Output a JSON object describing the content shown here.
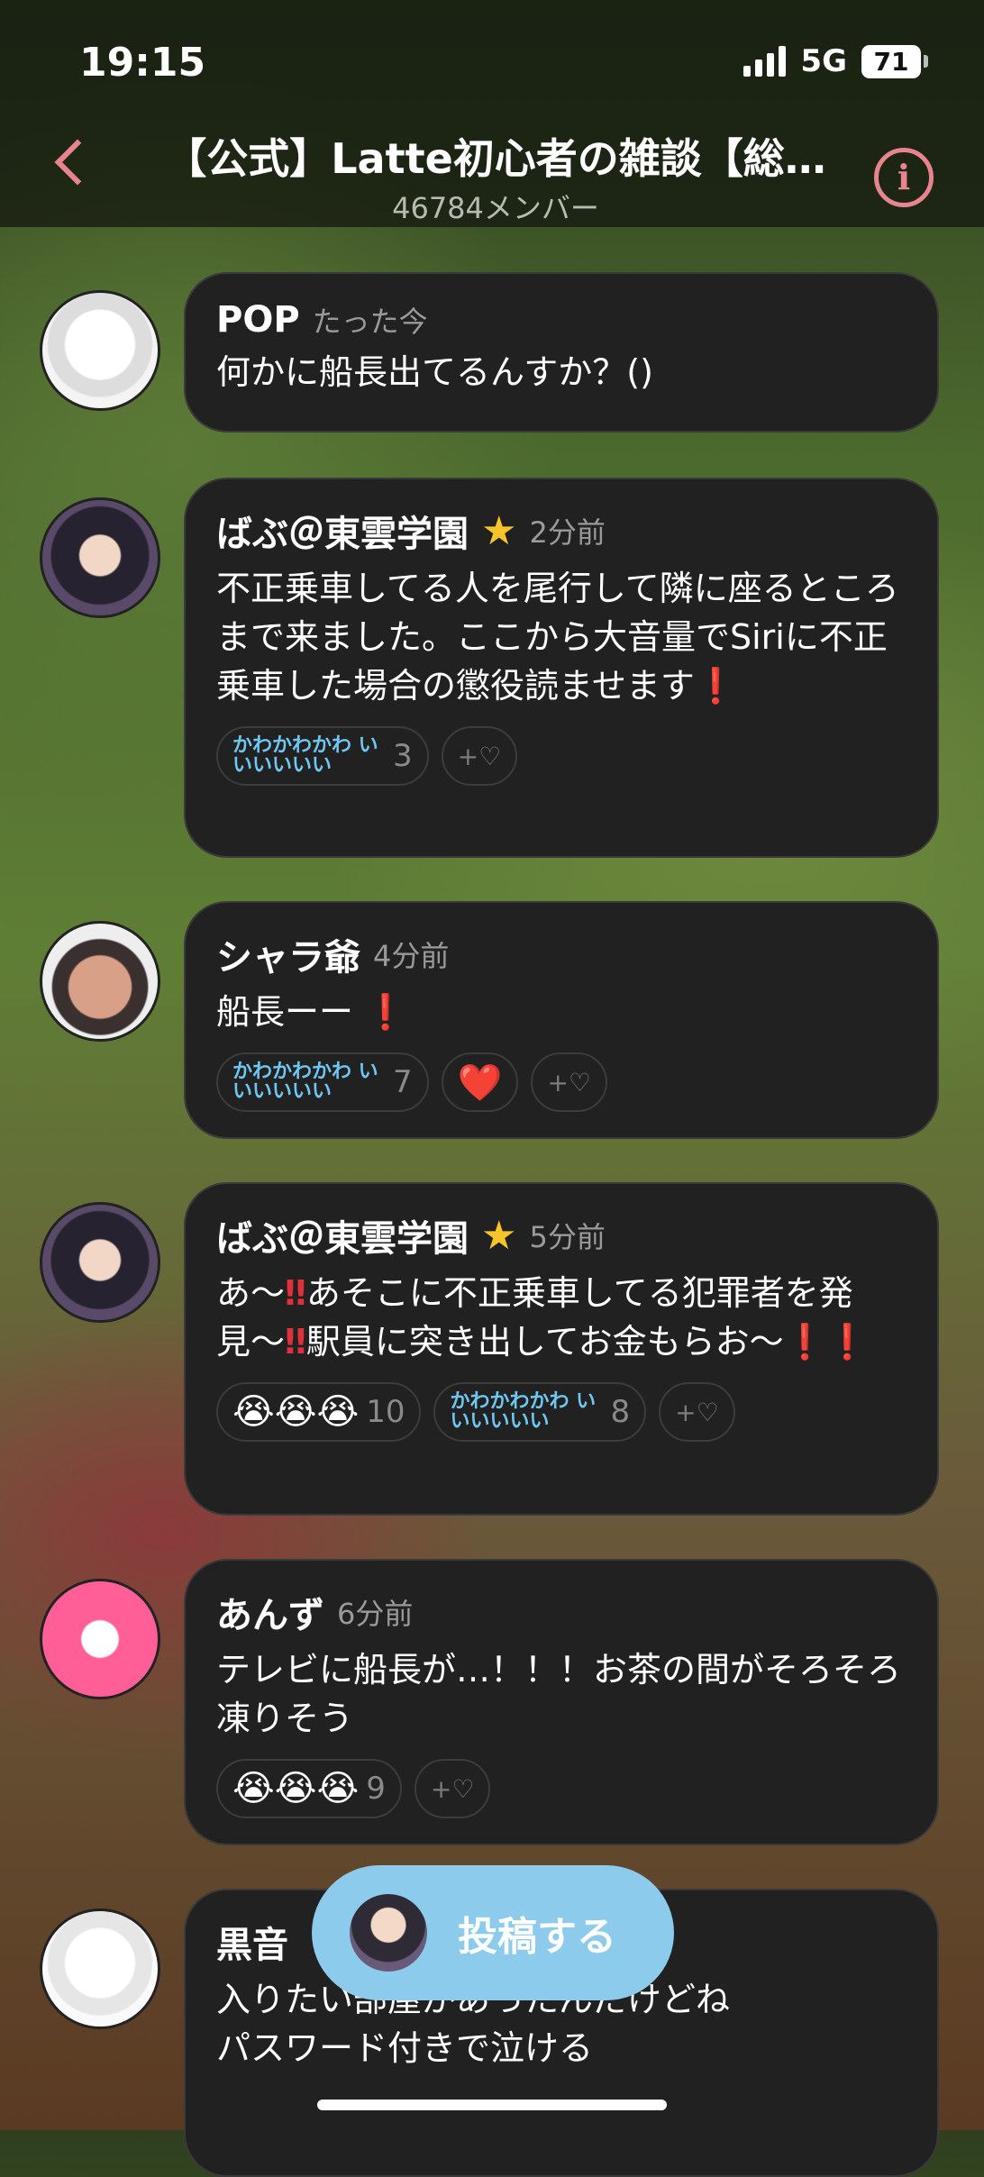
{
  "status": {
    "time": "19:15",
    "network": "5G",
    "battery": "71"
  },
  "header": {
    "title": "【公式】Latte初心者の雑談【総…",
    "members": "46784メンバー"
  },
  "messages": [
    {
      "name": "POP",
      "time": "たった今",
      "text": "何かに船長出てるんすか？()",
      "reactions": []
    },
    {
      "name": "ばぶ＠東雲学園",
      "time": "2分前",
      "text": "不正乗車してる人を尾行して隣に座るところまで来ました。ここから大音量でSiriに不正乗車した場合の懲役読ませます",
      "reactions": [
        {
          "label": "かわかわかわ いいいいいい",
          "count": "3"
        }
      ]
    },
    {
      "name": "シャラ爺",
      "time": "4分前",
      "text": "船長ーー",
      "reactions": [
        {
          "label": "かわかわかわ いいいいいい",
          "count": "7"
        },
        {
          "emoji": "❤️"
        }
      ]
    },
    {
      "name": "ばぶ＠東雲学園",
      "time": "5分前",
      "text_parts": [
        "あ〜",
        "あそこに不正乗車してる犯罪者を発見〜",
        "駅員に突き出してお金もらお〜"
      ],
      "reactions": [
        {
          "emoji": "😭😭😭",
          "count": "10"
        },
        {
          "label": "かわかわかわ いいいいいい",
          "count": "8"
        }
      ]
    },
    {
      "name": "あんず",
      "time": "6分前",
      "text": "テレビに船長が…！！！お茶の間がそろそろ凍りそう",
      "reactions": [
        {
          "emoji": "😭😭😭",
          "count": "9"
        }
      ]
    },
    {
      "name": "黒音",
      "time": "",
      "text": "入りたい部屋があったんだけどね\nパスワード付きで泣ける",
      "reactions": []
    }
  ],
  "add_reaction": "+♡",
  "post_button": {
    "label": "投稿する"
  },
  "colors": {
    "accent": "#e8838f",
    "post_button": "#8ccbeb",
    "bubble": "#212121",
    "reaction_text": "#6ec7f0"
  }
}
